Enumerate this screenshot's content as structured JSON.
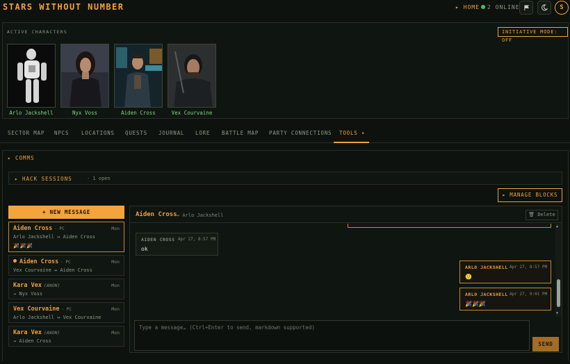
{
  "app": {
    "title": "STARS WITHOUT NUMBER",
    "home_label": "▸ HOME",
    "online_label": "2 ONLINE",
    "avatar_initial": "S",
    "accent_color": "#f2a03d"
  },
  "characters_panel": {
    "label": "ACTIVE CHARACTERS",
    "initiative_label": "INITIATIVE MODE: OFF",
    "characters": [
      {
        "name": "Arlo Jackshell"
      },
      {
        "name": "Nyx Voss"
      },
      {
        "name": "Aiden Cross"
      },
      {
        "name": "Vex Courvaine"
      }
    ]
  },
  "tabs": [
    {
      "label": "SECTOR MAP"
    },
    {
      "label": "NPCS"
    },
    {
      "label": "LOCATIONS"
    },
    {
      "label": "QUESTS"
    },
    {
      "label": "JOURNAL"
    },
    {
      "label": "LORE"
    },
    {
      "label": "BATTLE MAP"
    },
    {
      "label": "PARTY CONNECTIONS"
    },
    {
      "label": "TOOLS ▾",
      "active": true
    }
  ],
  "comms": {
    "title": "▸ COMMS",
    "hack_sessions_label": "▸ HACK SESSIONS",
    "hack_sessions_count": "· 1 open",
    "manage_blocks_label": "▸ MANAGE BLOCKS",
    "new_message_label": "+ NEW MESSAGE",
    "threads": [
      {
        "name": "Aiden Cross",
        "tag": "· PC",
        "day": "Mon",
        "sub": "Arlo Jackshell ↔ Aiden Cross",
        "preview": "🎉🎉🎉",
        "selected": true
      },
      {
        "name": "Aiden Cross",
        "tag": "· PC",
        "day": "Mon",
        "sub": "Vex Courvaine ↔ Aiden Cross",
        "unread": true
      },
      {
        "name": "Kara Vex",
        "tag": "(ANON)",
        "day": "Mon",
        "sub": "→ Nyx Voss"
      },
      {
        "name": "Vex Courvaine",
        "tag": "· PC",
        "day": "Mon",
        "sub": "Arlo Jackshell ↔ Vex Courvaine"
      },
      {
        "name": "Kara Vex",
        "tag": "(ANON)",
        "day": "Mon",
        "sub": "→ Aiden Cross"
      }
    ],
    "conversation": {
      "name": "Aiden Cross",
      "with": "↔ Arlo Jackshell",
      "delete_label": "🗑 Delete",
      "messages": [
        {
          "author": "AIDEN CROSS",
          "time": "Apr 27, 8:57 PM",
          "text": "ok",
          "mine": false
        },
        {
          "author": "ARLO JACKSHELL",
          "time": "Apr 27, 8:57 PM",
          "text": "🙂",
          "mine": true
        },
        {
          "author": "ARLO JACKSHELL",
          "time": "Apr 27, 9:01 PM",
          "text": "🎉🎉🎉",
          "mine": true
        }
      ],
      "compose_placeholder": "Type a message… (Ctrl+Enter to send, markdown supported)",
      "send_label": "SEND"
    }
  }
}
